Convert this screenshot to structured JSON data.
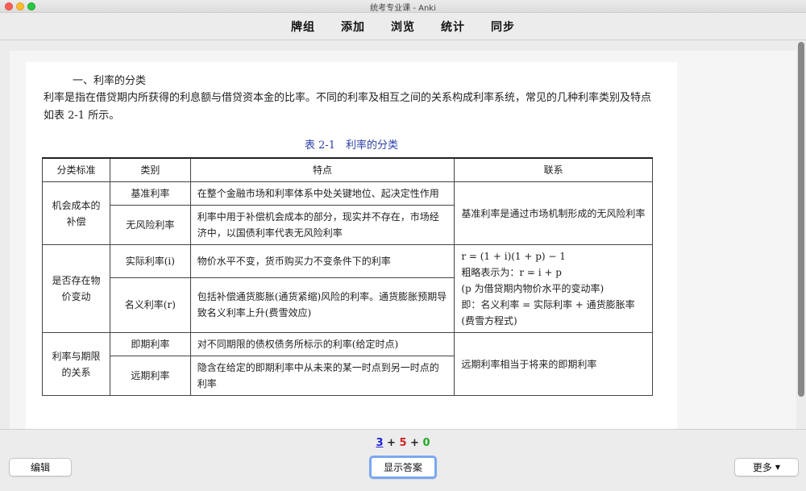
{
  "window": {
    "title": "统考专业课 - Anki"
  },
  "nav": [
    {
      "label": "牌组"
    },
    {
      "label": "添加"
    },
    {
      "label": "浏览"
    },
    {
      "label": "统计"
    },
    {
      "label": "同步"
    }
  ],
  "card": {
    "heading": "一、利率的分类",
    "paragraph": "利率是指在借贷期内所获得的利息额与借贷资本金的比率。不同的利率及相互之间的关系构成利率系统，常见的几种利率类别及特点如表 2-1 所示。",
    "table_caption": "表 2-1　利率的分类",
    "table": {
      "headers": [
        "分类标准",
        "类别",
        "特点",
        "联系"
      ],
      "groups": [
        {
          "criterion": "机会成本的补偿",
          "link": "基准利率是通过市场机制形成的无风险利率",
          "rows": [
            {
              "category": "基准利率",
              "feature": "在整个金融市场和利率体系中处关键地位、起决定性作用"
            },
            {
              "category": "无风险利率",
              "feature": "利率中用于补偿机会成本的部分，现实并不存在，市场经济中，以国债利率代表无风险利率"
            }
          ]
        },
        {
          "criterion": "是否存在物价变动",
          "link_lines": [
            "r = (1 + i)(1 + p) − 1",
            "粗略表示为：r = i + p",
            "(p 为借贷期内物价水平的变动率)",
            "即：名义利率 = 实际利率 + 通货膨胀率(费雪方程式)"
          ],
          "rows": [
            {
              "category": "实际利率(i)",
              "feature": "物价水平不变，货币购买力不变条件下的利率"
            },
            {
              "category": "名义利率(r)",
              "feature": "包括补偿通货膨胀(通货紧缩)风险的利率。通货膨胀预期导致名义利率上升(费雪效应)"
            }
          ]
        },
        {
          "criterion": "利率与期限的关系",
          "link": "远期利率相当于将来的即期利率",
          "rows": [
            {
              "category": "即期利率",
              "feature": "对不同期限的债权债务所标示的利率(给定时点)"
            },
            {
              "category": "远期利率",
              "feature": "隐含在给定的即期利率中从未来的某一时点到另一时点的利率"
            }
          ]
        }
      ]
    }
  },
  "counts": {
    "new": "3",
    "learning": "5",
    "review": "0",
    "plus": "+"
  },
  "buttons": {
    "edit": "编辑",
    "show_answer": "显示答案",
    "more": "更多"
  },
  "colors": {
    "new": "#2222dd",
    "learning": "#cc2222",
    "review": "#22aa22",
    "focus_ring": "#7aa7f0"
  }
}
